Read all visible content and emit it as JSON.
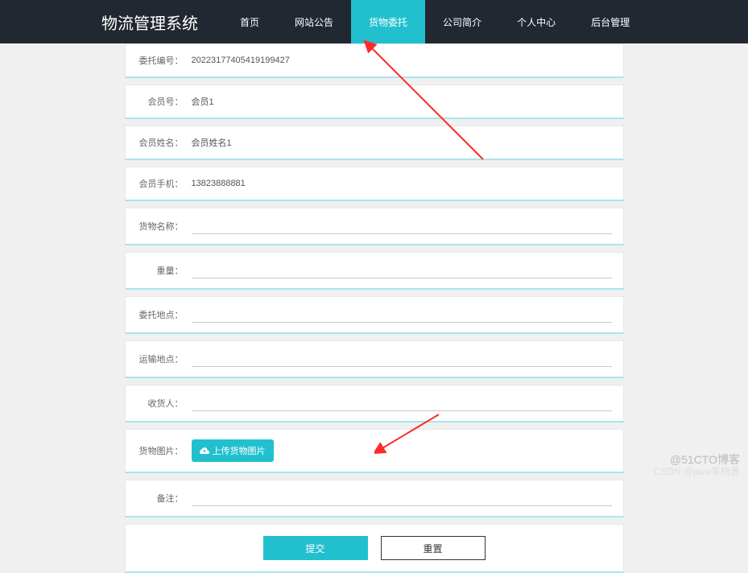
{
  "header": {
    "brand": "物流管理系统",
    "nav": [
      "首页",
      "网站公告",
      "货物委托",
      "公司简介",
      "个人中心",
      "后台管理"
    ],
    "activeIndex": 2
  },
  "form": {
    "orderNo": {
      "label": "委托编号：",
      "value": "20223177405419199427"
    },
    "memberNo": {
      "label": "会员号：",
      "value": "会员1"
    },
    "memberName": {
      "label": "会员姓名：",
      "value": "会员姓名1"
    },
    "memberPhone": {
      "label": "会员手机：",
      "value": "13823888881"
    },
    "goodsName": {
      "label": "货物名称：",
      "value": ""
    },
    "weight": {
      "label": "重量：",
      "value": ""
    },
    "entrustPlace": {
      "label": "委托地点：",
      "value": ""
    },
    "transportPlace": {
      "label": "运输地点：",
      "value": ""
    },
    "consignee": {
      "label": "收货人：",
      "value": ""
    },
    "goodsImage": {
      "label": "货物图片：",
      "uploadText": "上传货物图片"
    },
    "remark": {
      "label": "备注：",
      "value": ""
    }
  },
  "buttons": {
    "submit": "提交",
    "reset": "重置"
  },
  "watermark": "@51CTO博客",
  "watermark2": "CSDN @java李杨勇"
}
